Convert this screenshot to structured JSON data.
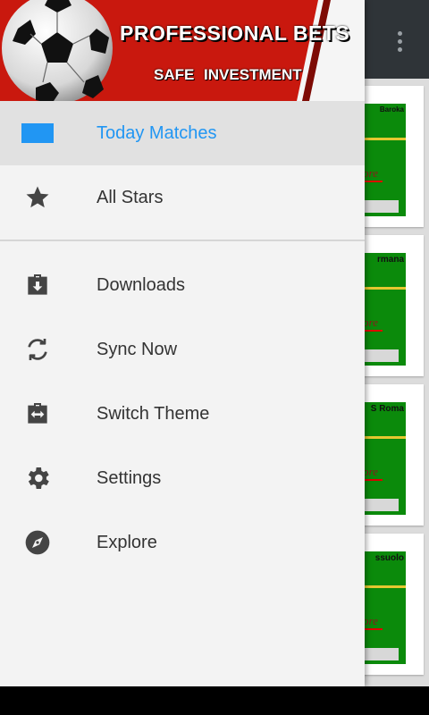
{
  "header": {
    "title": "PROFESSIONAL BETS",
    "subtitle": "SAFE INVESTMENT"
  },
  "menu": {
    "primary": [
      {
        "label": "Today Matches",
        "icon": "rectangle-icon",
        "active": true
      },
      {
        "label": "All Stars",
        "icon": "star-icon"
      }
    ],
    "secondary": [
      {
        "label": "Downloads",
        "icon": "download-icon"
      },
      {
        "label": "Sync Now",
        "icon": "sync-icon"
      },
      {
        "label": "Switch Theme",
        "icon": "switch-theme-icon"
      },
      {
        "label": "Settings",
        "icon": "gear-icon"
      },
      {
        "label": "Explore",
        "icon": "compass-icon"
      }
    ]
  },
  "background_cards": [
    {
      "team": "Baroka",
      "more": "ore"
    },
    {
      "team": "rmana",
      "more": "ore"
    },
    {
      "team": "S Roma",
      "more": "ore"
    },
    {
      "team": "ssuolo",
      "more": "ore"
    }
  ],
  "colors": {
    "accent": "#2196f3",
    "header_red": "#c9180e",
    "card_green": "#0b8a0b",
    "toolbar": "#2f3438"
  }
}
